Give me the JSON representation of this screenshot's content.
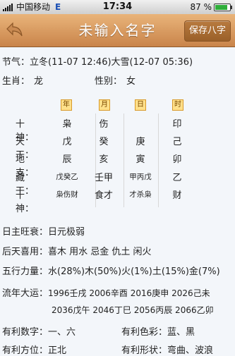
{
  "status": {
    "carrier": "中国移动",
    "network": "E",
    "time": "17:34",
    "battery": "87 %",
    "battery_level": 0.87
  },
  "header": {
    "title": "未输入名字",
    "save_label": "保存八字"
  },
  "info": {
    "jieqi_label": "节气：",
    "jieqi_value": "立冬(11-07 12:46)大雪(12-07 05:36)",
    "zodiac_label": "生肖：",
    "zodiac_value": "龙",
    "gender_label": "性别：",
    "gender_value": "女"
  },
  "pillars": {
    "headers": [
      "年",
      "月",
      "日",
      "时"
    ],
    "row_labels": [
      "十神：",
      "天干：",
      "地支：",
      "藏干：",
      "十神："
    ],
    "rows": [
      [
        "枭",
        "伤",
        "",
        "印"
      ],
      [
        "戊",
        "癸",
        "庚",
        "己"
      ],
      [
        "辰",
        "亥",
        "寅",
        "卯"
      ],
      [
        "戊癸乙",
        "壬甲",
        "甲丙戊",
        "乙"
      ],
      [
        "枭伤财",
        "食才",
        "才杀枭",
        "财"
      ]
    ]
  },
  "analysis": {
    "strength_label": "日主旺衰：",
    "strength_value": "日元极弱",
    "favor_label": "后天喜用：",
    "favor_value": "喜木  用水  忌金  仇土  闲火",
    "elements_label": "五行力量：",
    "elements_value": "水(28%)木(50%)火(1%)土(15%)金(7%)",
    "luck_label": "流年大运：",
    "luck_line1": "1996壬戌  2006辛酉  2016庚申  2026己未",
    "luck_line2": "2036戊午  2046丁巳  2056丙辰  2066乙卯",
    "number_label": "有利数字：",
    "number_value": "一、六",
    "color_label": "有利色彩：",
    "color_value": "蓝、黑",
    "direction_label": "有利方位：",
    "direction_value": "正北",
    "shape_label": "有利形状：",
    "shape_value": "弯曲、波浪"
  }
}
